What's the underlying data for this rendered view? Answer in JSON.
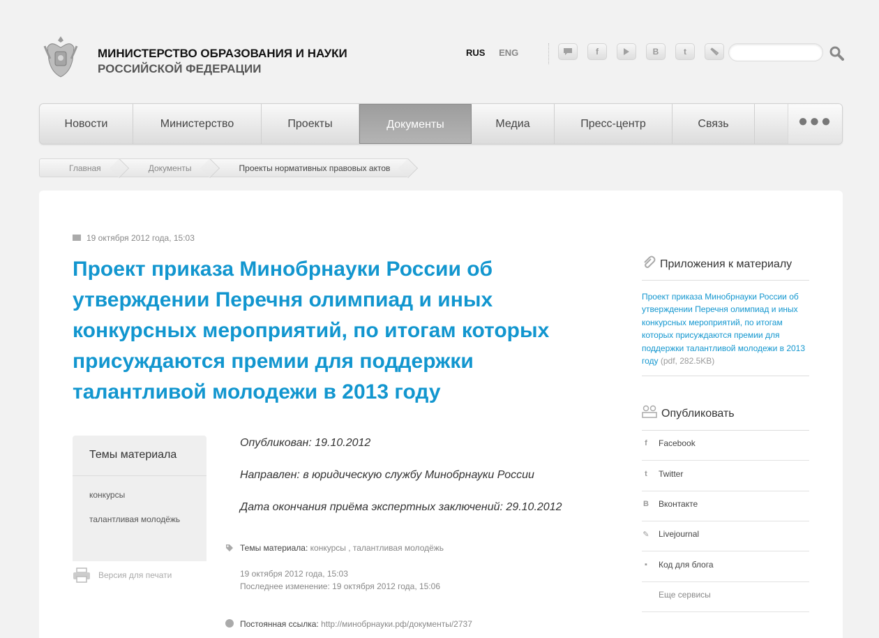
{
  "header": {
    "org_line1": "МИНИСТЕРСТВО ОБРАЗОВАНИЯ И НАУКИ",
    "org_line2": "РОССИЙСКОЙ ФЕДЕРАЦИИ",
    "lang_active": "RUS",
    "lang_other": "ENG",
    "social_icons": [
      "comment-icon",
      "facebook-icon",
      "youtube-icon",
      "vkontakte-icon",
      "twitter-icon",
      "livejournal-icon"
    ],
    "search_placeholder": ""
  },
  "nav": {
    "items": [
      "Новости",
      "Министерство",
      "Проекты",
      "Документы",
      "Медиа",
      "Пресс-центр",
      "Связь"
    ],
    "active_index": 3,
    "more_label": "●●●"
  },
  "breadcrumb": [
    "Главная",
    "Документы",
    "Проекты нормативных правовых актов"
  ],
  "article": {
    "date": "19 октября 2012 года, 15:03",
    "title": "Проект приказа Минобрнауки России об утверждении Перечня олимпиад и иных конкурсных мероприятий, по итогам которых присуждаются премии для поддержки талантливой молодежи в 2013 году",
    "published": "Опубликован: 19.10.2012",
    "directed": "Направлен: в юридическую службу Минобрнауки России",
    "deadline": "Дата окончания приёма экспертных заключений: 29.10.2012",
    "topics_label": "Темы материала:",
    "topics_values": "конкурсы , талантливая молодёжь",
    "created": "19 октября 2012 года, 15:03",
    "modified": "Последнее изменение: 19 октября 2012 года, 15:06",
    "permalink_label": "Постоянная ссылка:",
    "permalink_url": "http://минобрнауки.рф/документы/2737"
  },
  "topics_box": {
    "title": "Темы материала",
    "tags": [
      "конкурсы",
      "талантливая молодёжь"
    ]
  },
  "print_label": "Версия для печати",
  "sidebar": {
    "attachments_title": "Приложения к материалу",
    "attachment_link": "Проект приказа Минобрнауки России об утверждении Перечня олимпиад и иных конкурсных мероприятий, по итогам которых присуждаются премии для поддержки талантливой молодежи в 2013 году",
    "attachment_meta": "(pdf, 282.5KB)",
    "publish_title": "Опубликовать",
    "share": [
      "Facebook",
      "Twitter",
      "Вконтакте",
      "Livejournal",
      "Код для блога",
      "Еще сервисы"
    ]
  },
  "colors": {
    "accent": "#1296cf",
    "background": "#f2f2f2",
    "nav_active": "#a3a3a3"
  }
}
